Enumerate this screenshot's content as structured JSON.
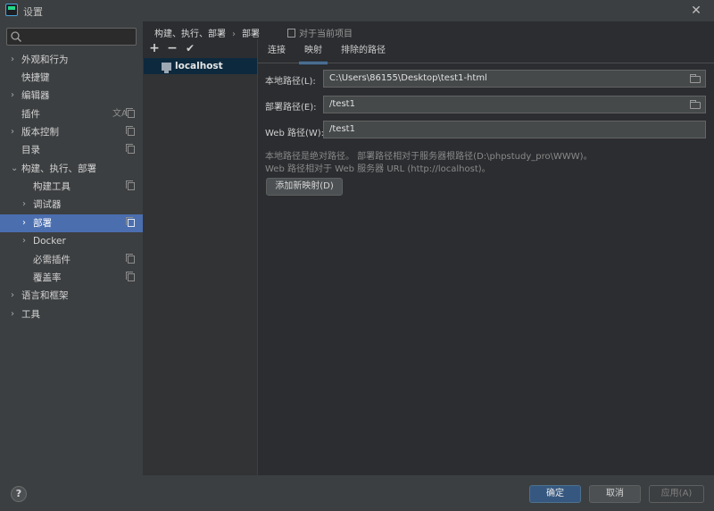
{
  "window": {
    "title": "设置",
    "close_glyph": "✕"
  },
  "search": {
    "placeholder": ""
  },
  "sidebar": {
    "items": [
      {
        "label": "外观和行为",
        "expandable": true
      },
      {
        "label": "快捷键"
      },
      {
        "label": "编辑器",
        "expandable": true
      },
      {
        "label": "插件",
        "translate_icon": "文A"
      },
      {
        "label": "版本控制",
        "expandable": true
      },
      {
        "label": "目录"
      },
      {
        "label": "构建、执行、部署",
        "expanded": true
      },
      {
        "label": "构建工具"
      },
      {
        "label": "调试器",
        "expandable": true
      },
      {
        "label": "部署",
        "expandable": true,
        "selected": true
      },
      {
        "label": "Docker",
        "expandable": true
      },
      {
        "label": "必需插件"
      },
      {
        "label": "覆盖率"
      },
      {
        "label": "语言和框架",
        "expandable": true
      },
      {
        "label": "工具",
        "expandable": true
      }
    ]
  },
  "breadcrumb": {
    "items": [
      "构建、执行、部署",
      "部署"
    ],
    "separator": "›"
  },
  "project_note": {
    "icon": "copy-icon",
    "text": "对于当前项目"
  },
  "list_toolbar": {
    "add": "+",
    "remove": "−",
    "check": "✔"
  },
  "server_list": {
    "items": [
      "localhost"
    ]
  },
  "tabs": [
    {
      "label": "连接"
    },
    {
      "label": "映射",
      "active": true
    },
    {
      "label": "排除的路径"
    }
  ],
  "form": {
    "local_path_label": "本地路径(L):",
    "local_path_value": "C:\\Users\\86155\\Desktop\\test1-html",
    "deploy_path_label": "部署路径(E):",
    "deploy_path_value": "/test1",
    "web_path_label": "Web 路径(W):",
    "web_path_value": "/test1"
  },
  "notes": {
    "line1": "本地路径是绝对路径。 部署路径相对于服务器根路径(D:\\phpstudy_pro\\WWW)。",
    "line2": "Web 路径相对于 Web 服务器 URL (http://localhost)。"
  },
  "add_mapping_button": "添加新映射(D)",
  "buttons": {
    "help": "?",
    "ok": "确定",
    "cancel": "取消",
    "apply": "应用(A)"
  },
  "colors": {
    "selected_bg": "#4b6eaf",
    "accent_tab": "#4a88c7",
    "ok_button": "#365880"
  }
}
